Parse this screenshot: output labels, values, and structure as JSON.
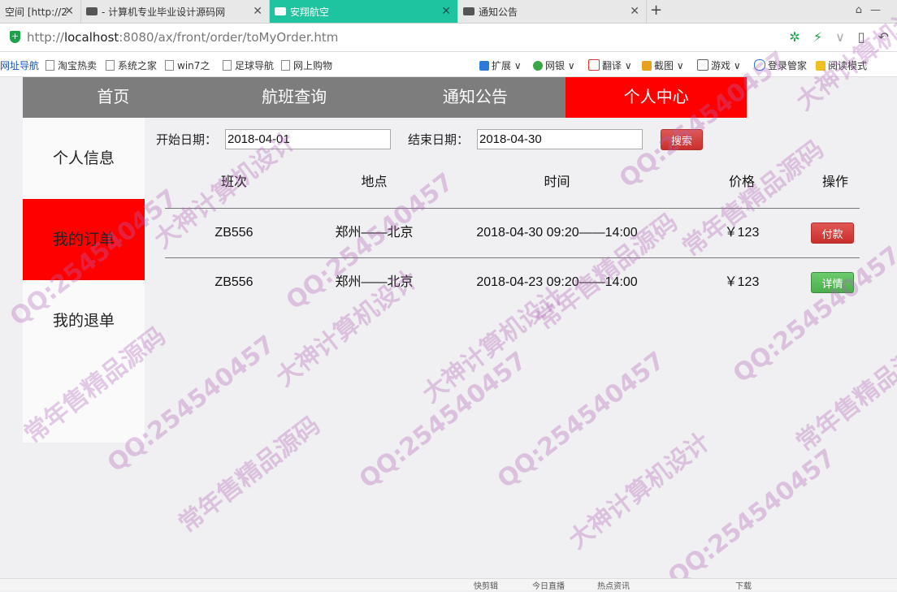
{
  "browser": {
    "tabs": [
      {
        "label": "空间 [http://2",
        "active": false
      },
      {
        "label": "- 计算机专业毕业设计源码网",
        "active": false
      },
      {
        "label": "安翔航空",
        "active": true
      },
      {
        "label": "通知公告",
        "active": false
      }
    ],
    "url_prefix": "http://",
    "url_host": "localhost",
    "url_path": ":8080/ax/front/order/toMyOrder.htm",
    "bookmarks": [
      "网址导航",
      "淘宝热卖",
      "系统之家",
      "win7之",
      "足球导航",
      "网上购物"
    ],
    "tools": [
      "扩展",
      "网银",
      "翻译",
      "截图",
      "游戏",
      "登录管家",
      "阅读模式"
    ],
    "status_items": [
      "快剪辑",
      "今日直播",
      "热点资讯",
      "下载"
    ]
  },
  "nav": {
    "items": [
      "首页",
      "航班查询",
      "通知公告",
      "个人中心"
    ],
    "active_index": 3
  },
  "sidebar": {
    "items": [
      "个人信息",
      "我的订单",
      "我的退单"
    ],
    "active_index": 1
  },
  "search": {
    "start_label": "开始日期：",
    "start_value": "2018-04-01",
    "end_label": "结束日期：",
    "end_value": "2018-04-30",
    "button_label": "搜索"
  },
  "table": {
    "headers": [
      "班次",
      "地点",
      "时间",
      "价格",
      "操作"
    ],
    "rows": [
      {
        "flight": "ZB556",
        "route": "郑州——北京",
        "time": "2018-04-30 09:20——14:00",
        "price": "￥123",
        "action": "付款"
      },
      {
        "flight": "ZB556",
        "route": "郑州——北京",
        "time": "2018-04-23 09:20——14:00",
        "price": "￥123",
        "action": "详情"
      }
    ]
  },
  "watermark": {
    "texts": [
      "QQ:254540457",
      "常年售精品源码",
      "大神计算机设计"
    ]
  },
  "colors": {
    "active_red": "#ff0000",
    "nav_gray": "#7d7d7d",
    "pay_button": "#c9302c",
    "detail_button": "#4cae4c",
    "tab_active": "#1ec4a0"
  }
}
